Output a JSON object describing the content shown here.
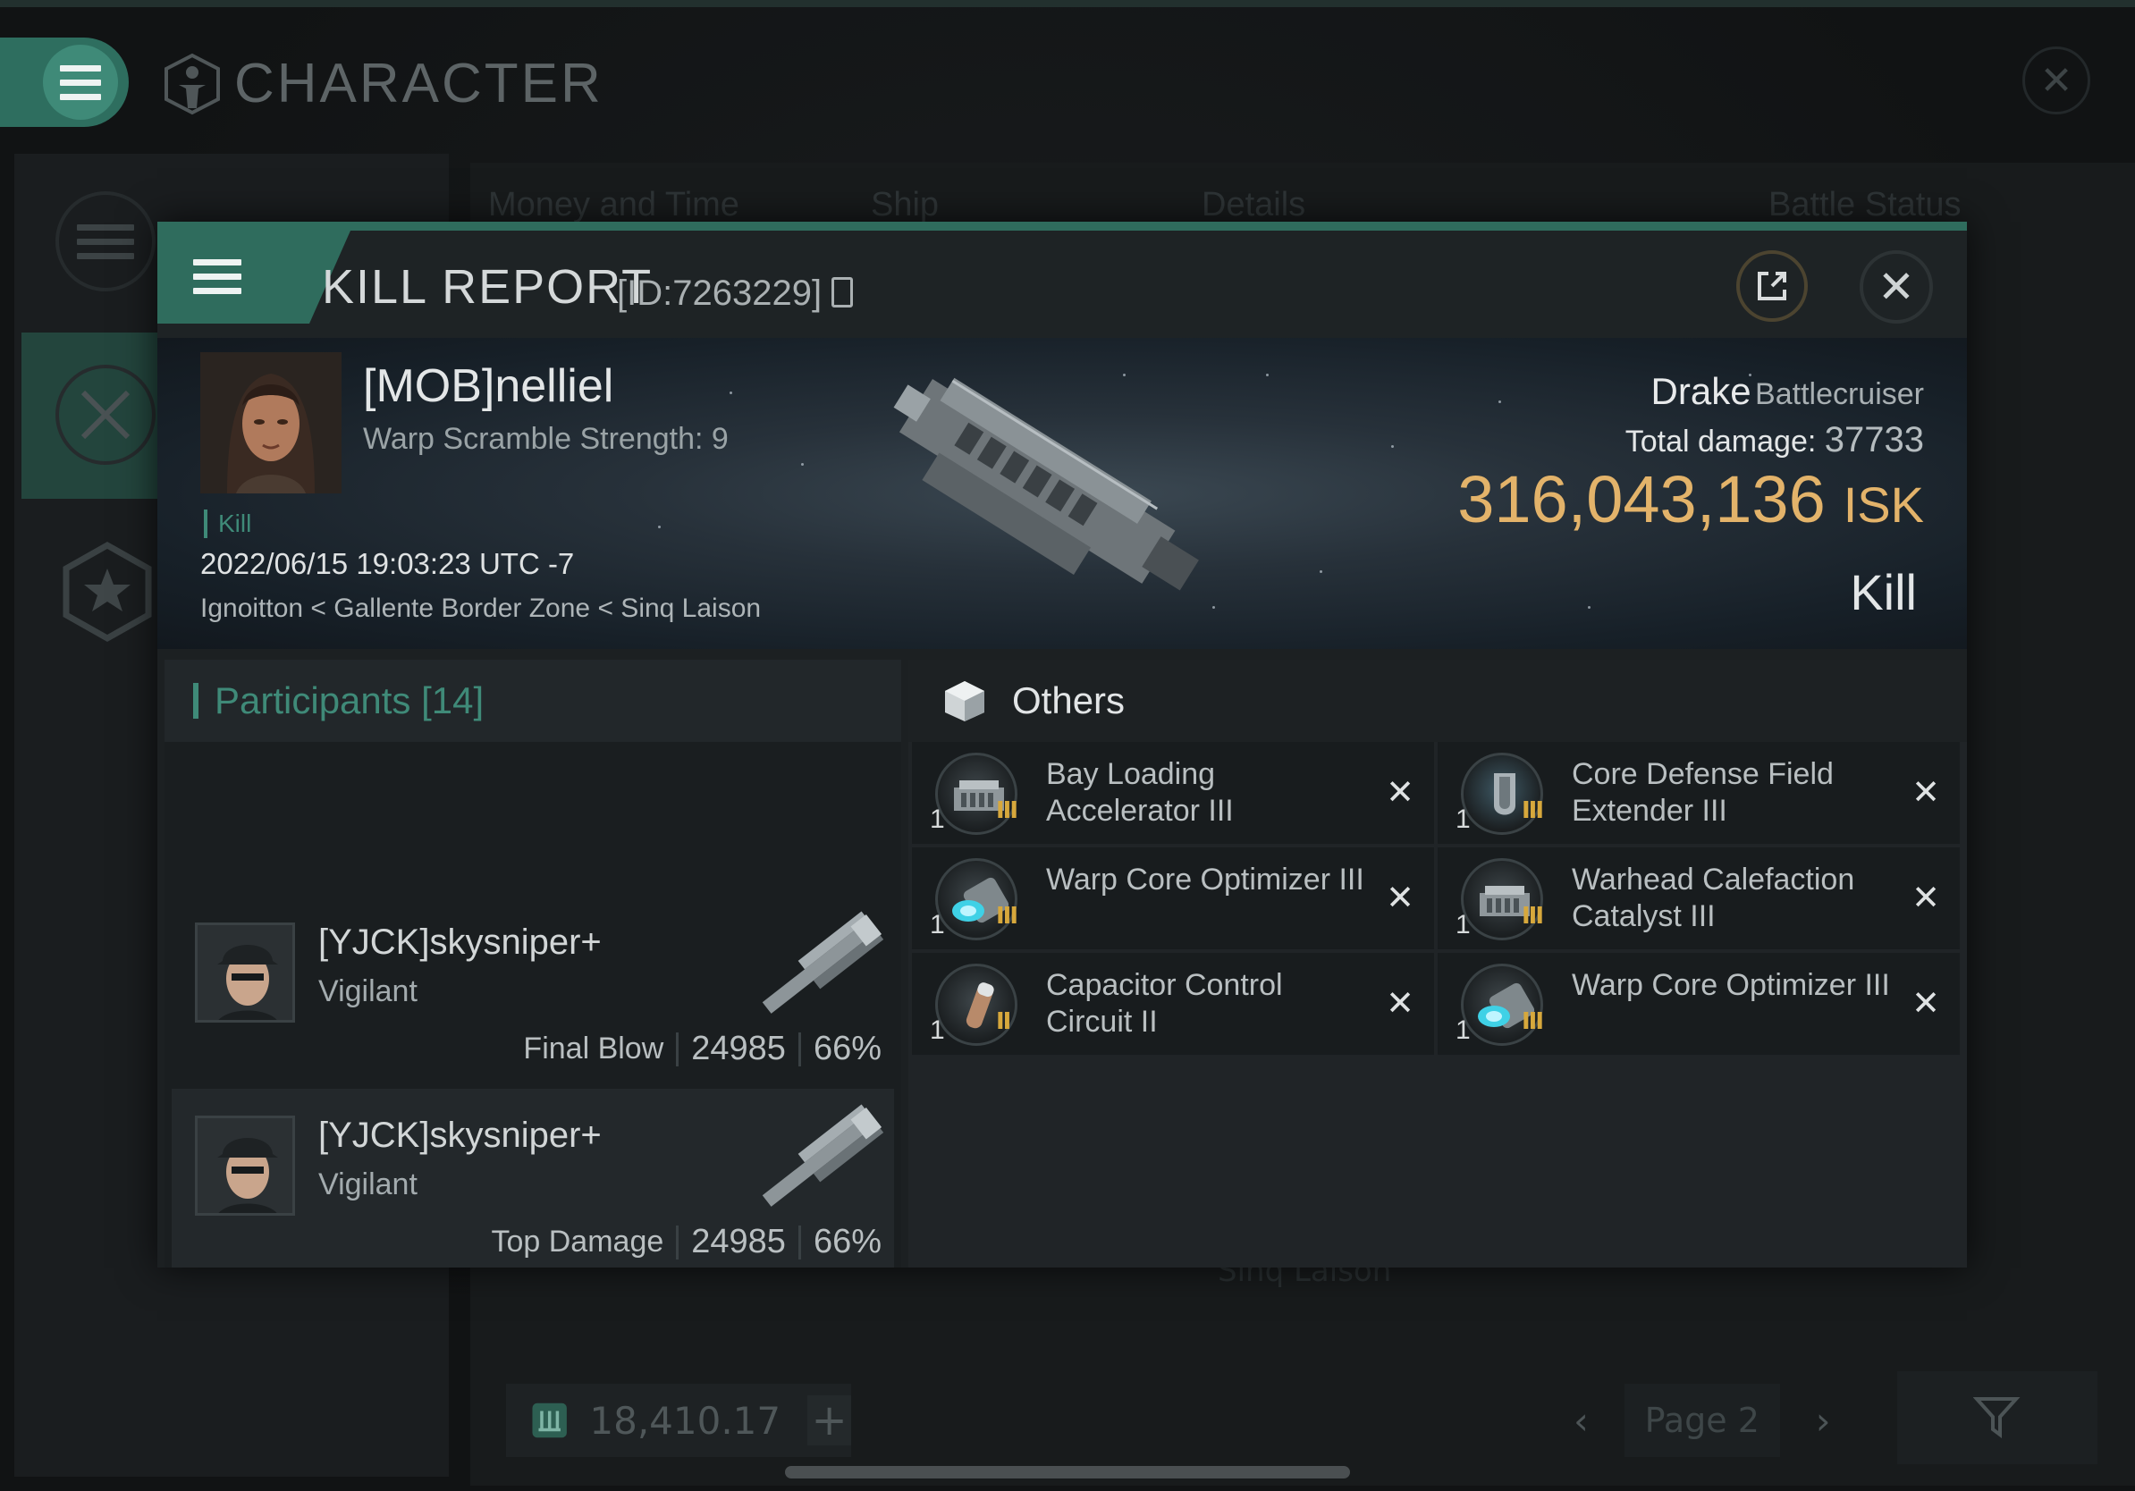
{
  "app": {
    "title": "CHARACTER",
    "bg_tabs": [
      "Money and Time",
      "Ship",
      "Details",
      "Battle Status"
    ],
    "bg_location": "Sinq Laison",
    "wallet_value": "18,410.17",
    "page_label": "Page 2"
  },
  "modal": {
    "title": "KILL REPORT",
    "report_id": "[ID:7263229]"
  },
  "victim": {
    "name": "[MOB]nelliel",
    "warp_scramble": "Warp Scramble Strength: 9",
    "kill_tag": "Kill",
    "datetime": "2022/06/15 19:03:23 UTC -7",
    "location": "Ignoitton < Gallente Border Zone < Sinq Laison",
    "ship_name": "Drake",
    "ship_class": "Battlecruiser",
    "total_damage_label": "Total damage:",
    "total_damage": "37733",
    "isk_value": "316,043,136",
    "isk_unit": "ISK",
    "status": "Kill"
  },
  "participants": {
    "label": "Participants",
    "count": "[14]",
    "rows": [
      {
        "name": "[YJCK]skysniper+",
        "ship": "Vigilant",
        "role": "Final Blow",
        "damage": "24985",
        "percent": "66%"
      },
      {
        "name": "[YJCK]skysniper+",
        "ship": "Vigilant",
        "role": "Top Damage",
        "damage": "24985",
        "percent": "66%"
      }
    ]
  },
  "items": {
    "section_label": "Others",
    "list": [
      {
        "qty": "1",
        "name": "Bay Loading Accelerator III",
        "tier": "III",
        "icon": "bay-loading-icon"
      },
      {
        "qty": "1",
        "name": "Core Defense Field Extender III",
        "tier": "III",
        "icon": "field-extender-icon"
      },
      {
        "qty": "1",
        "name": "Warp Core Optimizer III",
        "tier": "III",
        "icon": "warp-core-icon"
      },
      {
        "qty": "1",
        "name": "Warhead Calefaction Catalyst III",
        "tier": "III",
        "icon": "warhead-icon"
      },
      {
        "qty": "1",
        "name": "Capacitor Control Circuit II",
        "tier": "II",
        "icon": "capacitor-icon"
      },
      {
        "qty": "1",
        "name": "Warp Core Optimizer III",
        "tier": "III",
        "icon": "warp-core-icon"
      }
    ]
  },
  "colors": {
    "accent": "#2f6c5d",
    "isk_gold": "#e3b36a",
    "tier_gold": "#d7a83c"
  }
}
